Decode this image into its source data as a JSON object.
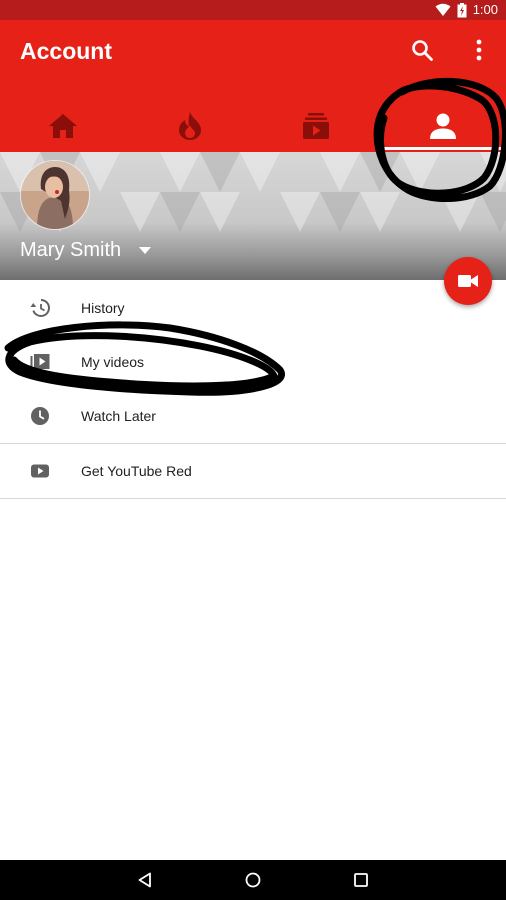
{
  "status_bar": {
    "time": "1:00",
    "icons": [
      "wifi-icon",
      "battery-icon"
    ]
  },
  "app_bar": {
    "title": "Account",
    "actions": [
      "search-icon",
      "more-vert-icon"
    ],
    "tabs": [
      {
        "name": "home",
        "icon": "home-icon",
        "active": false
      },
      {
        "name": "trending",
        "icon": "flame-icon",
        "active": false
      },
      {
        "name": "subscriptions",
        "icon": "subscriptions-icon",
        "active": false
      },
      {
        "name": "account",
        "icon": "account-icon",
        "active": true
      }
    ],
    "color": "#e62117"
  },
  "profile": {
    "name": "Mary Smith",
    "dropdown_icon": "caret-down-icon"
  },
  "fab": {
    "icon": "videocam-icon"
  },
  "menu": {
    "items": [
      {
        "label": "History",
        "icon": "history-icon"
      },
      {
        "label": "My videos",
        "icon": "my-videos-icon"
      },
      {
        "label": "Watch Later",
        "icon": "clock-icon"
      }
    ],
    "secondary": [
      {
        "label": "Get YouTube Red",
        "icon": "youtube-play-icon"
      }
    ]
  },
  "nav_bar": {
    "buttons": [
      "back-icon",
      "home-circle-icon",
      "recents-icon"
    ]
  }
}
